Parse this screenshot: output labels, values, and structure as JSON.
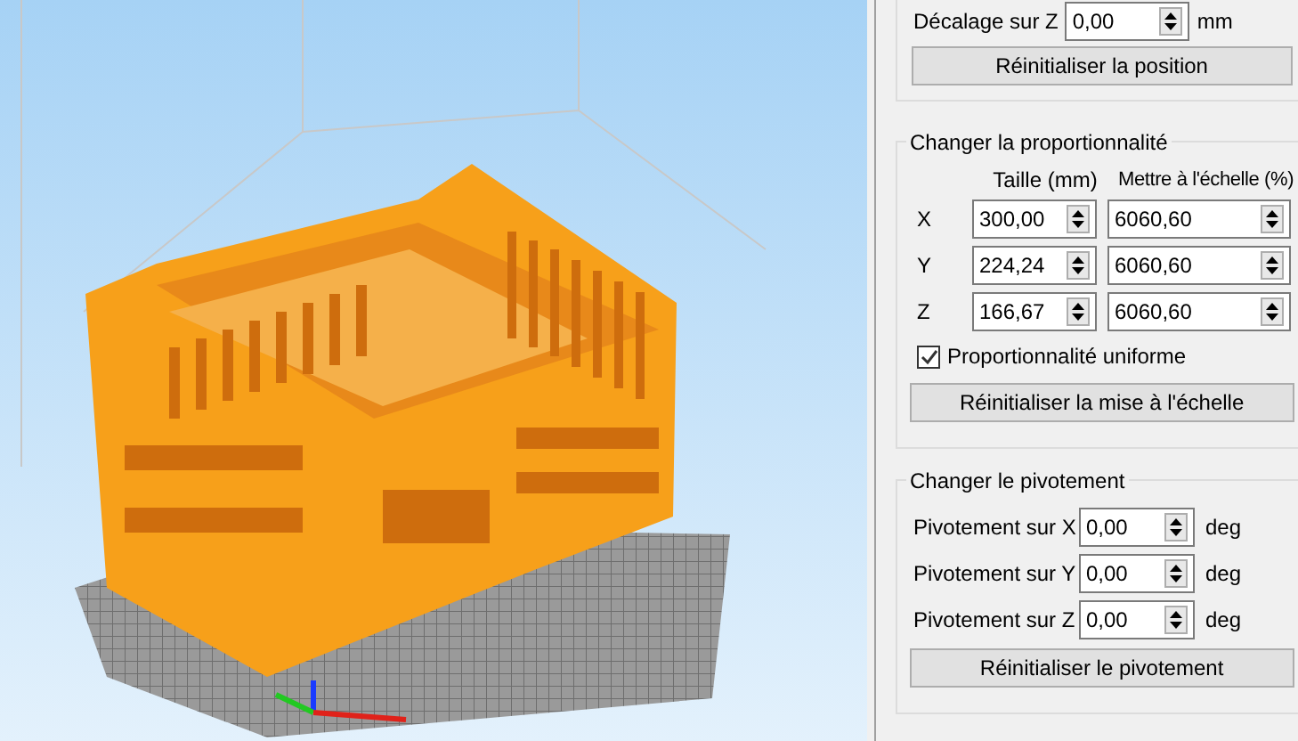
{
  "position": {
    "offset_z": {
      "label": "Décalage sur Z",
      "value": "0,00",
      "unit": "mm"
    },
    "reset_button": "Réinitialiser la position"
  },
  "scale": {
    "title": "Changer la proportionnalité",
    "columns": [
      "Taille (mm)",
      "Mettre à l'échelle (%)"
    ],
    "rows": [
      {
        "axis": "X",
        "size": "300,00",
        "percent": "6060,60"
      },
      {
        "axis": "Y",
        "size": "224,24",
        "percent": "6060,60"
      },
      {
        "axis": "Z",
        "size": "166,67",
        "percent": "6060,60"
      }
    ],
    "uniform": {
      "label": "Proportionnalité uniforme",
      "checked": true
    },
    "reset_button": "Réinitialiser la mise à l'échelle"
  },
  "rotation": {
    "title": "Changer le pivotement",
    "rows": [
      {
        "label": "Pivotement sur X",
        "value": "0,00",
        "unit": "deg"
      },
      {
        "label": "Pivotement sur Y",
        "value": "0,00",
        "unit": "deg"
      },
      {
        "label": "Pivotement sur Z",
        "value": "0,00",
        "unit": "deg"
      }
    ],
    "reset_button": "Réinitialiser le pivotement"
  }
}
